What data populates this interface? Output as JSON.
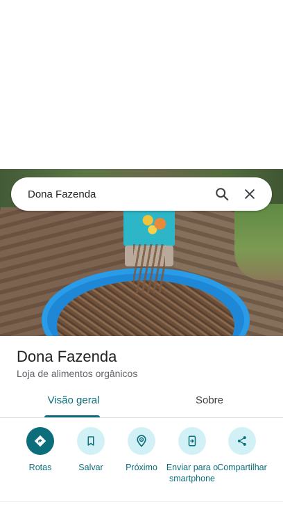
{
  "search": {
    "query": "Dona Fazenda"
  },
  "place": {
    "name": "Dona Fazenda",
    "category": "Loja de alimentos orgânicos"
  },
  "tabs": [
    {
      "label": "Visão geral",
      "selected": true
    },
    {
      "label": "Sobre",
      "selected": false
    }
  ],
  "actions": [
    {
      "label": "Rotas",
      "icon": "directions-icon"
    },
    {
      "label": "Salvar",
      "icon": "bookmark-icon"
    },
    {
      "label": "Próximo",
      "icon": "nearby-icon"
    },
    {
      "label": "Enviar para o smartphone",
      "icon": "send-to-phone-icon"
    },
    {
      "label": "Compartilhar",
      "icon": "share-icon"
    }
  ],
  "colors": {
    "accent": "#0b6e7a",
    "action_bg": "#d2f1f6"
  }
}
